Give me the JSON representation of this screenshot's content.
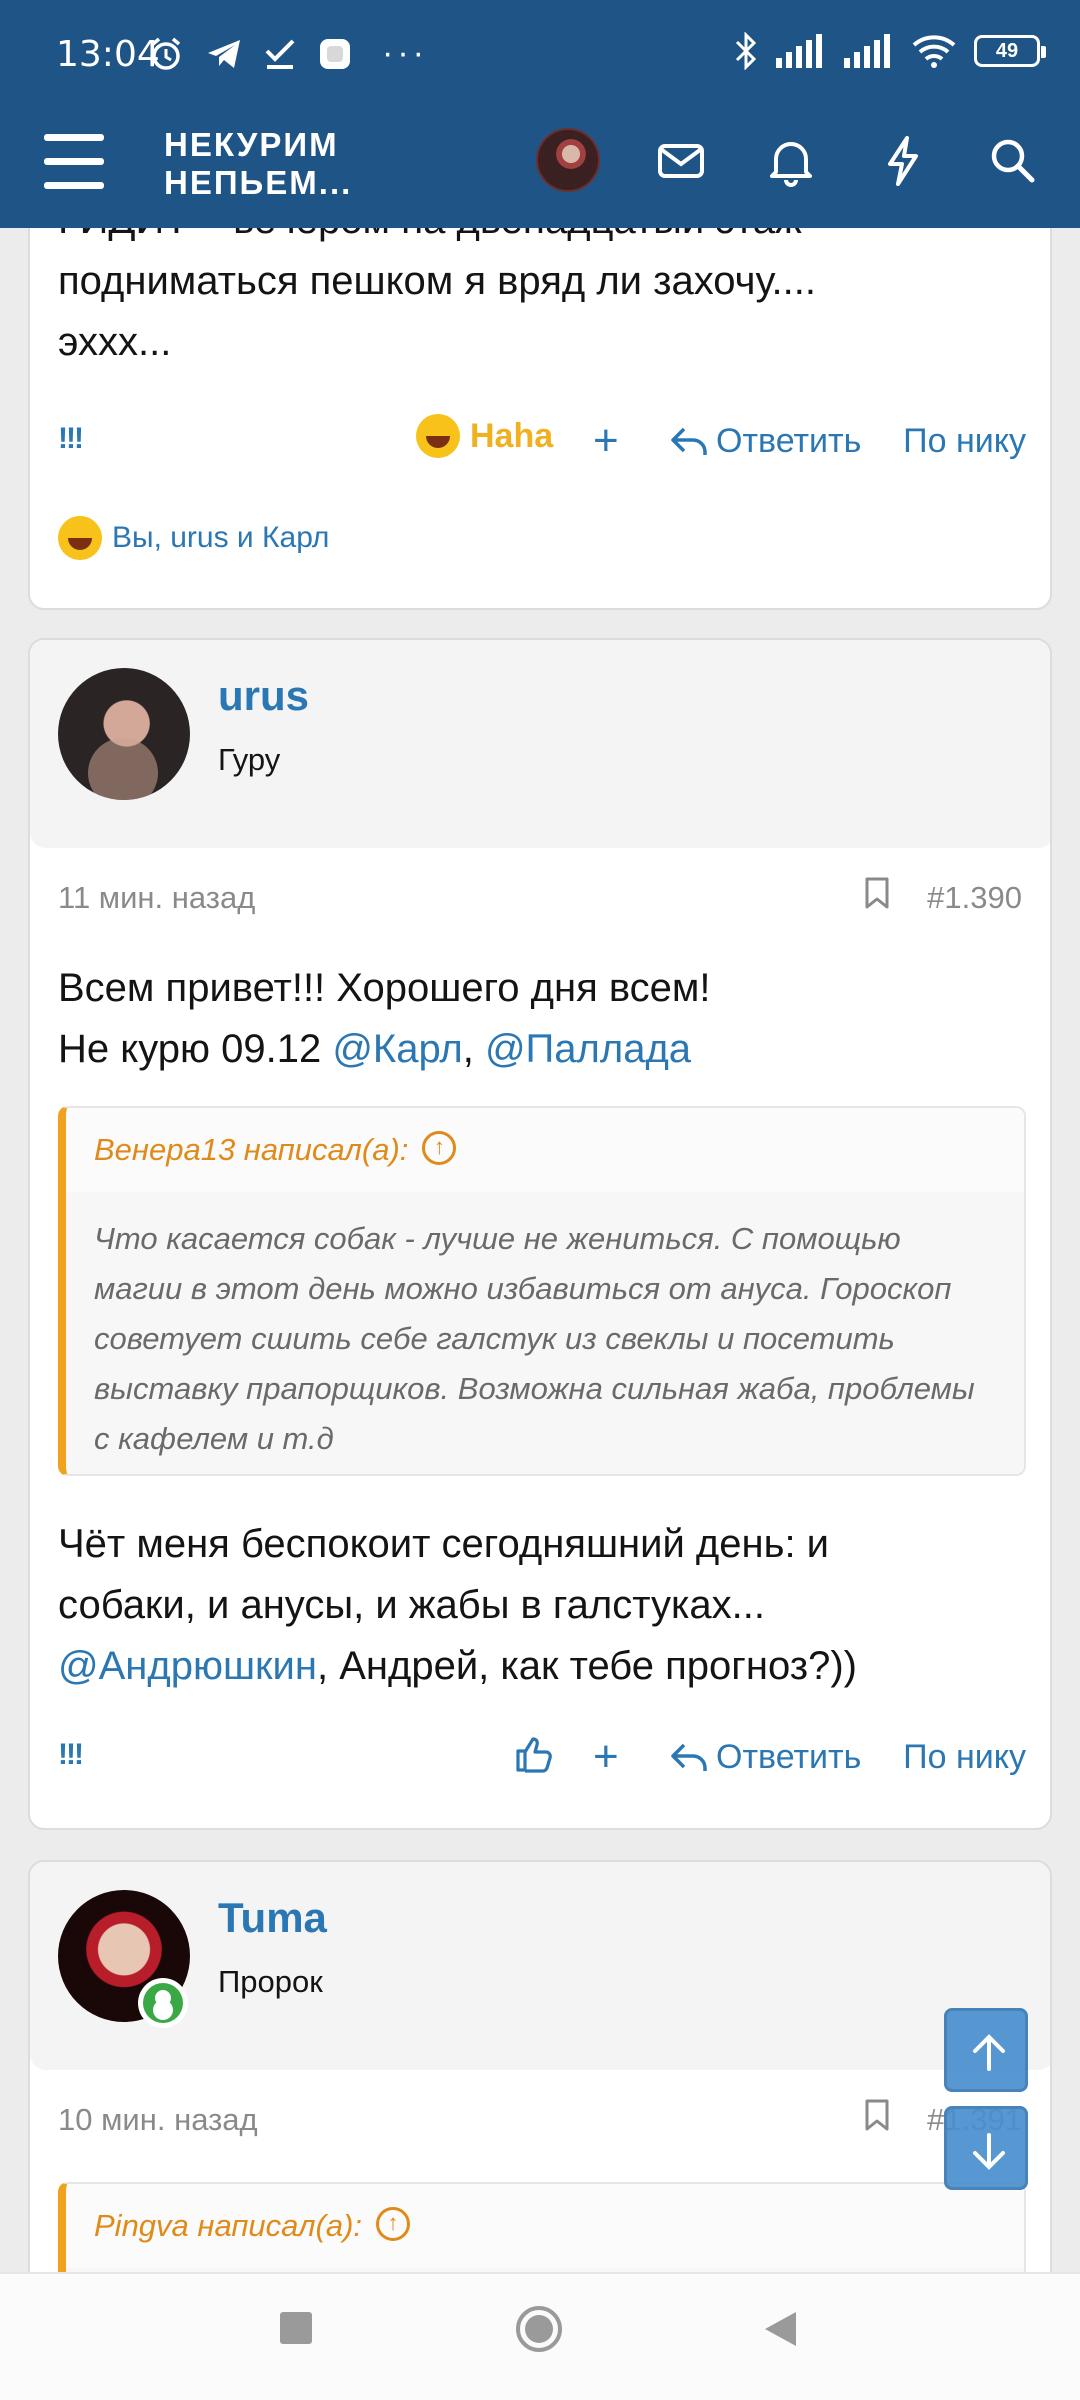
{
  "status": {
    "time": "13:04",
    "battery": "49",
    "overflow": "···"
  },
  "header": {
    "logo_line1": "НЕКУРИМ",
    "logo_line2": "НЕПЬЕМ..."
  },
  "post1": {
    "text_partial_top": "ГИДИТ – вечером на двенадцатый этаж",
    "text_line1": "подниматься пешком я вряд ли захочу....",
    "text_line2": "эххх...",
    "actions": {
      "bang": "!!!",
      "reaction_label": "Haha",
      "plus": "+",
      "reply": "Ответить",
      "by_nick": "По нику"
    },
    "reactions_text": "Вы, urus и Карл"
  },
  "post2": {
    "username": "urus",
    "user_title": "Гуру",
    "time": "11 мин. назад",
    "post_number": "#1.390",
    "text_line1": "Всем привет!!! Хорошего дня всем!",
    "text_line2_prefix": "Не курю 09.12 ",
    "mention1": "@Карл",
    "comma": ", ",
    "mention2": "@Паллада",
    "quote": {
      "author": "Венера13 написал(а):",
      "text": "Что касается собак - лучше не жениться. С помощью магии в этот день можно избавиться от ануса. Гороскоп советует сшить себе галстук из свеклы и посетить выставку прапорщиков. Возможна сильная жаба, проблемы с кафелем и т.д"
    },
    "text2_line1": "Чёт меня беспокоит сегодняшний день: и",
    "text2_line2": "собаки, и анусы, и жабы в галстуках...",
    "mention3": "@Андрюшкин",
    "text2_line3_rest": ", Андрей, как тебе прогноз?))",
    "actions": {
      "bang": "!!!",
      "plus": "+",
      "reply": "Ответить",
      "by_nick": "По нику"
    }
  },
  "post3": {
    "username": "Tuma",
    "user_title": "Пророк",
    "time": "10 мин. назад",
    "post_number": "#1.391",
    "quote_author": "Pingva написал(а):"
  },
  "colors": {
    "header": "#1f5486",
    "link": "#2b77b3",
    "quote_accent": "#f0a21e",
    "haha": "#f0b020"
  }
}
